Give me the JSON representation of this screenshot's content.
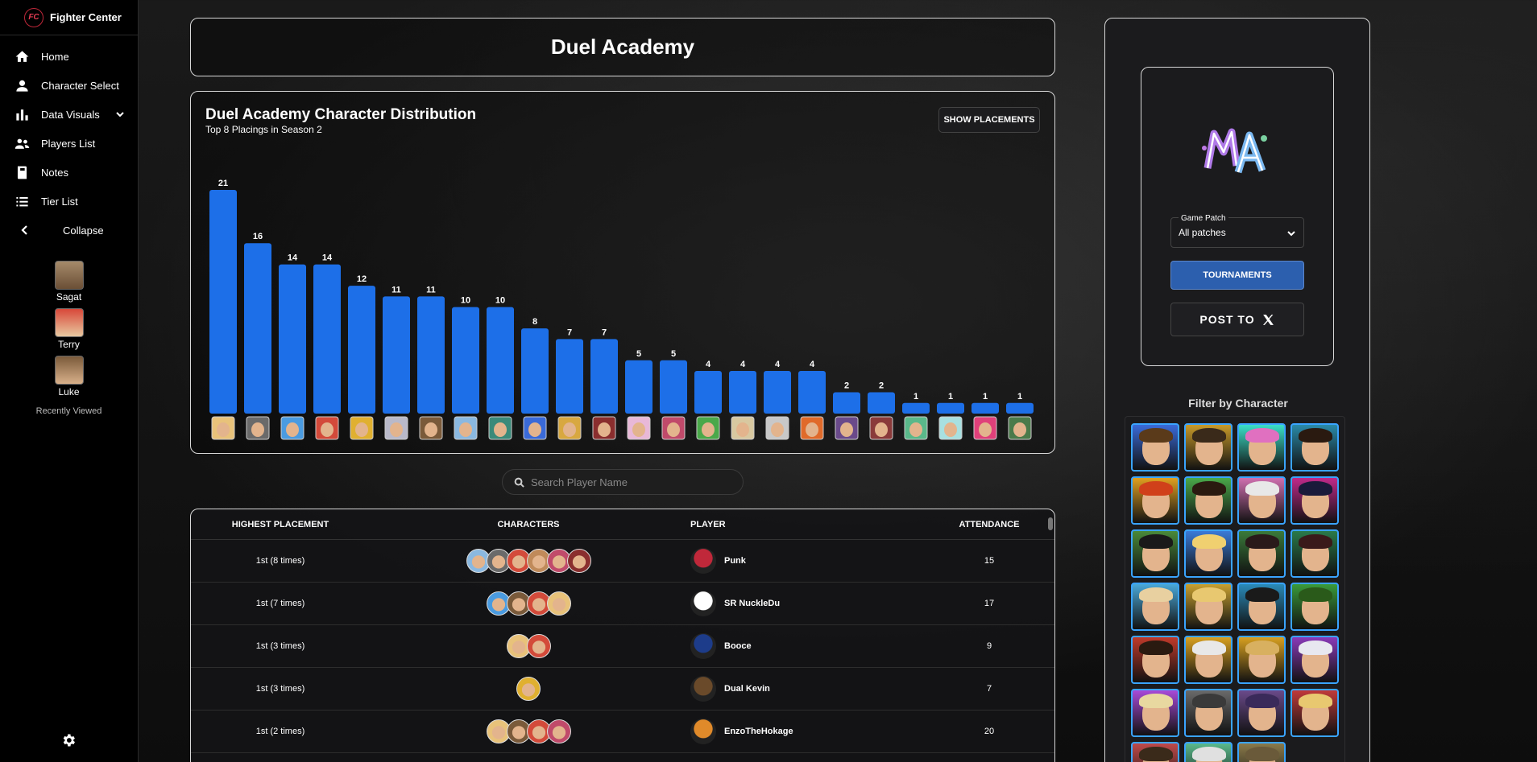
{
  "app": {
    "brand_initials": "FC",
    "brand_name": "Fighter Center"
  },
  "sidebar": {
    "items": [
      {
        "label": "Home",
        "icon": "home-icon"
      },
      {
        "label": "Character Select",
        "icon": "person-icon"
      },
      {
        "label": "Data Visuals",
        "icon": "bar-chart-icon"
      },
      {
        "label": "Players List",
        "icon": "people-icon"
      },
      {
        "label": "Notes",
        "icon": "book-icon"
      },
      {
        "label": "Tier List",
        "icon": "list-icon"
      }
    ],
    "collapse_label": "Collapse",
    "recent": [
      {
        "name": "Sagat",
        "color": "#8b6a4a"
      },
      {
        "name": "Terry",
        "color": "#c4473a"
      },
      {
        "name": "Luke",
        "color": "#b08a5a"
      }
    ],
    "recent_label": "Recently Viewed"
  },
  "page": {
    "title": "Duel Academy"
  },
  "chart": {
    "title": "Duel Academy Character Distribution",
    "subtitle": "Top 8 Placings in Season 2",
    "show_button": "SHOW PLACEMENTS",
    "bar_color": "#1d6fe8"
  },
  "chart_data": {
    "type": "bar",
    "title": "Duel Academy Character Distribution",
    "subtitle": "Top 8 Placings in Season 2",
    "values": [
      21,
      16,
      14,
      14,
      12,
      11,
      11,
      10,
      10,
      8,
      7,
      7,
      5,
      5,
      4,
      4,
      4,
      4,
      2,
      2,
      1,
      1,
      1,
      1
    ],
    "icon_colors": [
      "#e8c27a",
      "#6a6a6a",
      "#4a9be0",
      "#d34a3a",
      "#e0b030",
      "#b9b9c9",
      "#7a5a3a",
      "#8ab8e0",
      "#3a8a7a",
      "#3a6ad8",
      "#d8a840",
      "#8a2e2e",
      "#e8b8d8",
      "#c04a6a",
      "#4aa84a",
      "#d8c8a0",
      "#c8c8c8",
      "#e06a2a",
      "#6a4a8a",
      "#8a3a3a",
      "#5ab88a",
      "#a8e0e0",
      "#e0407a",
      "#4a7a4a"
    ],
    "ylim": [
      0,
      21
    ]
  },
  "search": {
    "placeholder": "Search Player Name"
  },
  "table": {
    "headers": {
      "placement": "HIGHEST PLACEMENT",
      "characters": "CHARACTERS",
      "player": "PLAYER",
      "attendance": "ATTENDANCE"
    },
    "rows": [
      {
        "placement": "1st (8 times)",
        "player": "Punk",
        "attendance": "15",
        "chars": [
          "#8ab8e0",
          "#6a6a6a",
          "#d34a3a",
          "#c08a5a",
          "#c04a6a",
          "#8a2e2e"
        ]
      },
      {
        "placement": "1st (7 times)",
        "player": "SR NuckleDu",
        "attendance": "17",
        "chars": [
          "#4a9be0",
          "#7a5a3a",
          "#d34a3a",
          "#e8c27a"
        ]
      },
      {
        "placement": "1st (3 times)",
        "player": "Booce",
        "attendance": "9",
        "chars": [
          "#e8c27a",
          "#d34a3a"
        ]
      },
      {
        "placement": "1st (3 times)",
        "player": "Dual Kevin",
        "attendance": "7",
        "chars": [
          "#e0b030"
        ]
      },
      {
        "placement": "1st (2 times)",
        "player": "EnzoTheHokage",
        "attendance": "20",
        "chars": [
          "#e8c27a",
          "#7a5a3a",
          "#d34a3a",
          "#c04a6a"
        ]
      }
    ]
  },
  "right": {
    "patch_label": "Game Patch",
    "patch_value": "All patches",
    "tournaments_label": "TOURNAMENTS",
    "post_label": "POST TO",
    "filter_title": "Filter by Character",
    "filter_tiles": [
      {
        "bg": "#3a6ad8",
        "hair": "#5a3a1a"
      },
      {
        "bg": "#c89a2a",
        "hair": "#3a2a1a"
      },
      {
        "bg": "#3ae0c8",
        "hair": "#e070c0"
      },
      {
        "bg": "#2a8aa8",
        "hair": "#2a1a10"
      },
      {
        "bg": "#e0a020",
        "hair": "#d0401a"
      },
      {
        "bg": "#4aa84a",
        "hair": "#2a1a10"
      },
      {
        "bg": "#d070b0",
        "hair": "#e8e8e8"
      },
      {
        "bg": "#c02a8a",
        "hair": "#1a1a3a"
      },
      {
        "bg": "#4a8a3a",
        "hair": "#1a1a1a"
      },
      {
        "bg": "#3a7ad8",
        "hair": "#f0d070"
      },
      {
        "bg": "#3a7a3a",
        "hair": "#2a1a1a"
      },
      {
        "bg": "#2a7a4a",
        "hair": "#3a1a1a"
      },
      {
        "bg": "#4aa8d8",
        "hair": "#e8d0a0"
      },
      {
        "bg": "#c8a030",
        "hair": "#e8c870"
      },
      {
        "bg": "#2a8ab8",
        "hair": "#1a1a1a"
      },
      {
        "bg": "#3a9a3a",
        "hair": "#2a5a1a"
      },
      {
        "bg": "#c03a2a",
        "hair": "#2a1a10"
      },
      {
        "bg": "#d8a020",
        "hair": "#e8e8e8"
      },
      {
        "bg": "#d8a020",
        "hair": "#d8b060"
      },
      {
        "bg": "#8a3ab8",
        "hair": "#e8e8f0"
      },
      {
        "bg": "#a84ad8",
        "hair": "#e8d8a0"
      },
      {
        "bg": "#6a6a6a",
        "hair": "#3a3a3a"
      },
      {
        "bg": "#6a4a8a",
        "hair": "#3a2a5a"
      },
      {
        "bg": "#c03a3a",
        "hair": "#e8c870"
      },
      {
        "bg": "#c04a4a",
        "hair": "#3a2a1a"
      },
      {
        "bg": "#5ab88a",
        "hair": "#e0e0e0"
      },
      {
        "bg": "#8a7a4a",
        "hair": "#6a5a3a"
      }
    ]
  }
}
